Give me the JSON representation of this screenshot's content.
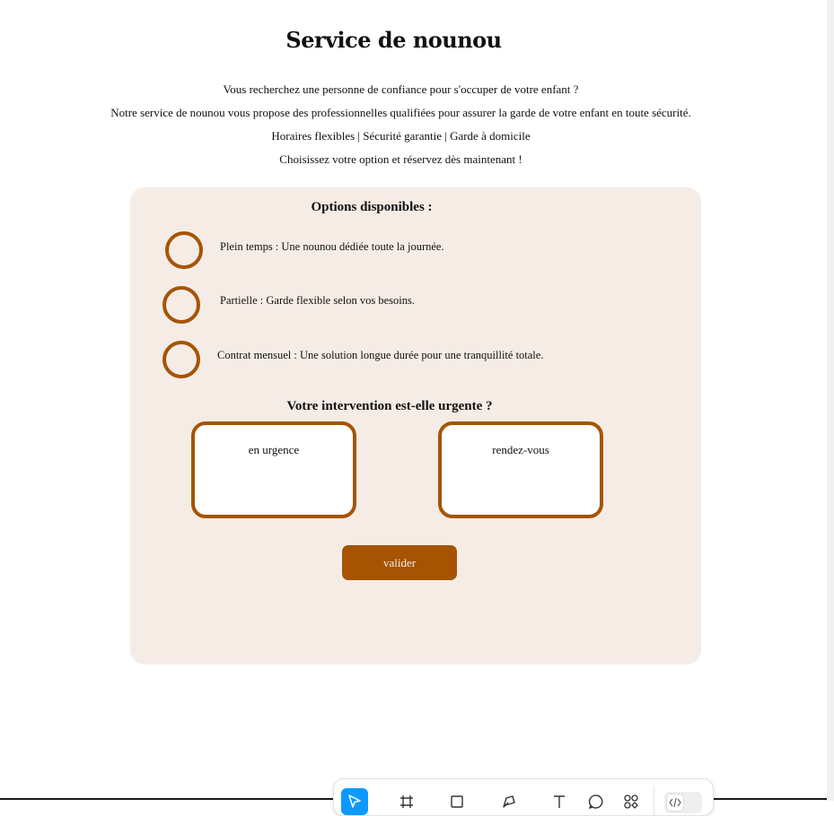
{
  "page": {
    "title": "Service de nounou",
    "intro": [
      "Vous recherchez une personne de confiance pour s'occuper de votre enfant ?",
      "Notre service de nounou vous propose des professionnelles qualifiées pour assurer la garde de votre enfant en toute sécurité.",
      "Horaires flexibles | Sécurité garantie | Garde à domicile",
      "Choisissez votre option et réservez dès maintenant !"
    ]
  },
  "form": {
    "options_title": "Options disponibles :",
    "options": [
      {
        "label": "Plein temps : Une nounou dédiée toute la journée."
      },
      {
        "label": "Partielle : Garde flexible selon vos besoins."
      },
      {
        "label": "Contrat mensuel : Une solution longue durée pour une tranquillité totale."
      }
    ],
    "urgency_title": "Votre intervention est-elle urgente ?",
    "urgency_choices": [
      {
        "label": "en urgence"
      },
      {
        "label": "rendez-vous"
      }
    ],
    "submit_label": "valider"
  },
  "colors": {
    "accent": "#a65402",
    "panel_bg": "#f5ece6",
    "toolbar_active": "#0d99ff"
  },
  "toolbar": {
    "tools": [
      {
        "name": "move-tool",
        "icon": "cursor-arrow-icon",
        "active": true
      },
      {
        "name": "frame-tool",
        "icon": "hash-frame-icon"
      },
      {
        "name": "shape-tool",
        "icon": "rectangle-icon"
      },
      {
        "name": "pen-tool",
        "icon": "pen-icon"
      },
      {
        "name": "text-tool",
        "icon": "text-icon"
      },
      {
        "name": "comment-tool",
        "icon": "comment-bubble-icon"
      },
      {
        "name": "components-tool",
        "icon": "components-icon"
      },
      {
        "name": "dev-mode-toggle",
        "icon": "code-brackets-icon"
      }
    ]
  }
}
